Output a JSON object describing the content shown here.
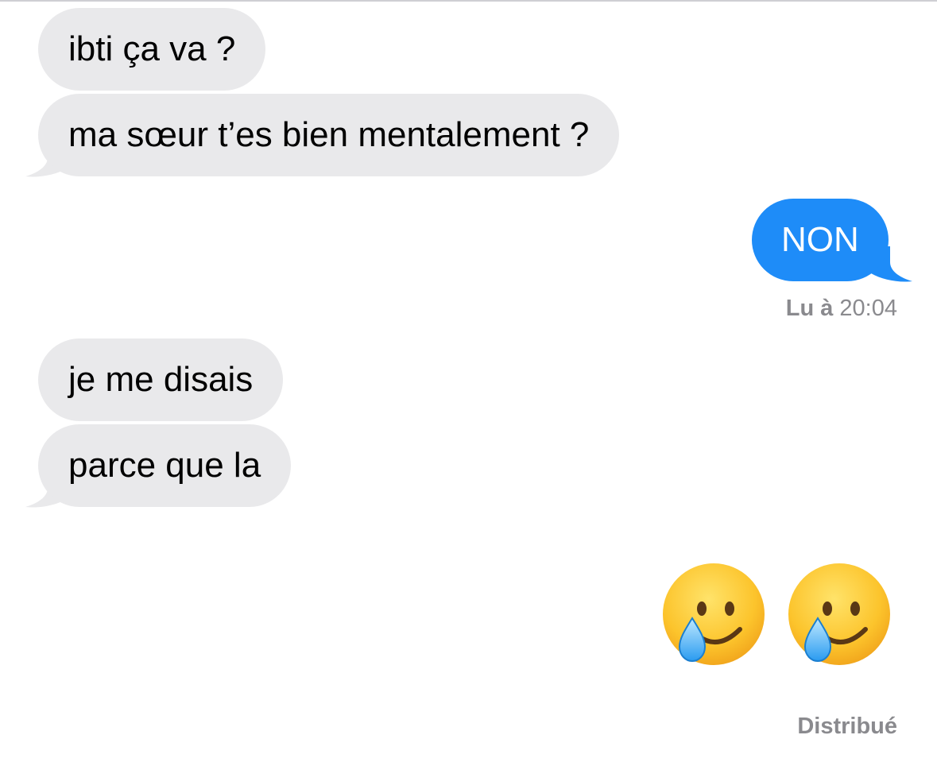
{
  "messages": {
    "received_1": "ibti ça va ?",
    "received_2": "ma sœur t’es bien mentalement ?",
    "sent_1": "NON",
    "received_3": "je me disais",
    "received_4": "parce que la"
  },
  "read_receipt": {
    "prefix": "Lu à",
    "time": "20:04"
  },
  "emojis": [
    "smiling-face-with-tear-icon",
    "smiling-face-with-tear-icon"
  ],
  "delivery_status": "Distribué",
  "colors": {
    "received_bubble": "#e9e9eb",
    "sent_bubble": "#1e8cf8",
    "status_text": "#8a8a8e"
  }
}
